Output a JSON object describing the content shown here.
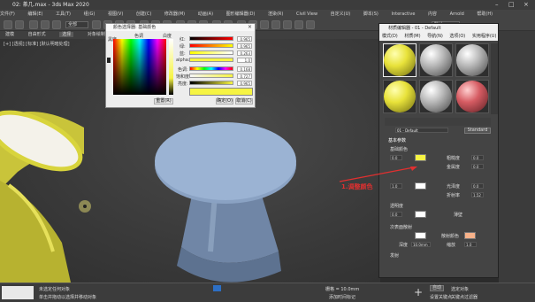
{
  "window": {
    "title": "02: 茶几.max - 3ds Max 2020"
  },
  "menubar": {
    "items": [
      "文件(F)",
      "编辑(E)",
      "工具(T)",
      "组(G)",
      "视图(V)",
      "创建(C)",
      "修改器(M)",
      "动画(A)",
      "图形编辑器(D)",
      "渲染(R)",
      "Civil View",
      "自定义(U)",
      "脚本(S)",
      "Interactive",
      "内容",
      "Arnold",
      "帮助(H)"
    ]
  },
  "toolbar": {
    "selection_filter": "全部",
    "workspace": "默认"
  },
  "ribbon": {
    "tabs": [
      "建模",
      "自由形式",
      "选择",
      "对象绘制",
      "填充"
    ]
  },
  "viewport": {
    "label": "[+] [透视] [标准] [默认明暗处理]"
  },
  "color_picker": {
    "title": "颜色选择器: 基础颜色",
    "hue_label": "色调",
    "whiteness_label": "白度",
    "blackness_label": "黑度",
    "channels": [
      {
        "label": "红:",
        "value": "0.965"
      },
      {
        "label": "绿:",
        "value": "0.965"
      },
      {
        "label": "蓝:",
        "value": "0.263"
      },
      {
        "label": "alpha:",
        "value": "1.0"
      },
      {
        "label": "色调:",
        "value": "0.168"
      },
      {
        "label": "饱和度:",
        "value": "0.727"
      },
      {
        "label": "亮度:",
        "value": "0.965"
      }
    ],
    "reset_label": "重置(R)",
    "ok_label": "确定(O)",
    "cancel_label": "取消(C)",
    "swatch_color": "#f6f443"
  },
  "material_editor": {
    "title": "材质编辑器 - 01 - Default",
    "menu": [
      "模式(D)",
      "材质(M)",
      "导航(N)",
      "选项(O)",
      "实用程序(U)"
    ],
    "material_name": "01 - Default",
    "material_type": "Standard",
    "rollout_title": "基本参数",
    "rows": [
      {
        "label": "基础颜色",
        "value": "0.0",
        "color": "#f6f443"
      },
      {
        "label": "粗糙度",
        "value": "0.0"
      },
      {
        "label": "金属度",
        "value": "0.0"
      },
      {
        "label": "反射",
        "value": "1.0"
      },
      {
        "label": "光泽度",
        "value": "0.0"
      },
      {
        "label": "折射率",
        "value": "1.52"
      }
    ],
    "transparency_label": "透明度",
    "transparency_value": "0.0",
    "thin_label": "薄壁",
    "subsurface_label": "次表面散射",
    "subsurface_color": "#f7b28a",
    "scatter_label": "散射颜色",
    "depth_label": "深度",
    "depth_value": "10.0mm",
    "scale_label": "缩放",
    "scale_value": "1.0",
    "emission_label": "发射",
    "annotation": "1.调整颜色"
  },
  "status": {
    "selected": "未选定任何对象",
    "hint": "单击并拖动以选择并移动对象",
    "grid": "栅格 = 10.0mm",
    "add_time_tag": "添加时间标记",
    "auto_key": "自动",
    "selected_obj": "选定对象",
    "set_key": "设置关键点",
    "key_filters": "关键点过滤器"
  },
  "colors": {
    "accent_red": "#e03030",
    "table_blue": "#8fa8c8",
    "yellow": "#f6f443"
  }
}
